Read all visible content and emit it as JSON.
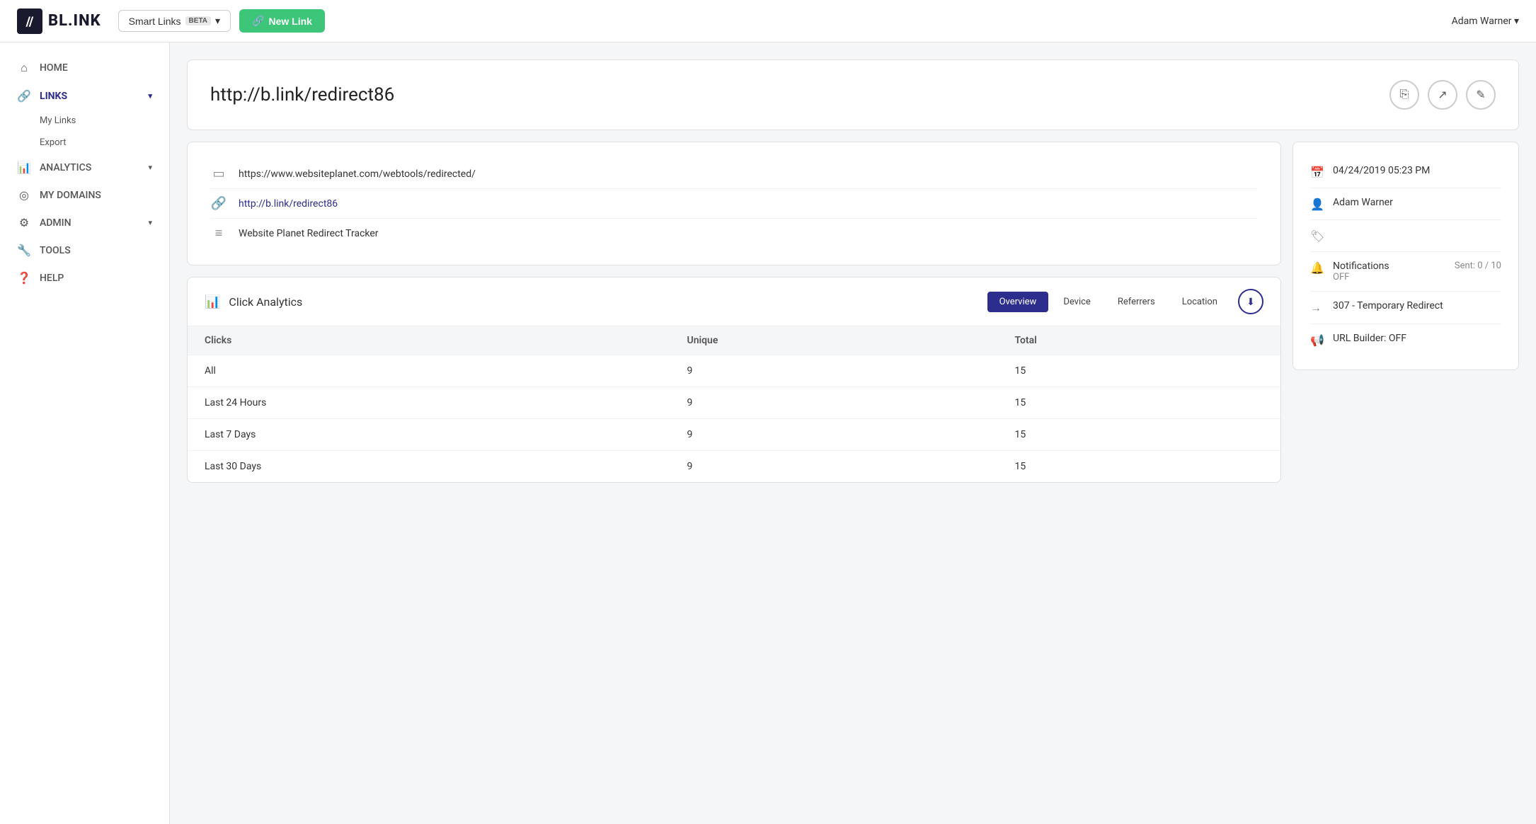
{
  "app": {
    "logo_text": "BL.INK",
    "smart_links_label": "Smart Links",
    "beta_badge": "BETA",
    "new_link_label": "New Link",
    "user_name": "Adam Warner ▾"
  },
  "sidebar": {
    "items": [
      {
        "id": "home",
        "label": "HOME",
        "icon": "⌂",
        "active": false
      },
      {
        "id": "links",
        "label": "LINKS",
        "icon": "🔗",
        "active": true,
        "has_chevron": true
      },
      {
        "id": "my-links",
        "label": "My Links",
        "sub": true
      },
      {
        "id": "export",
        "label": "Export",
        "sub": true
      },
      {
        "id": "analytics",
        "label": "ANALYTICS",
        "icon": "📊",
        "active": false,
        "has_chevron": true
      },
      {
        "id": "my-domains",
        "label": "MY DOMAINS",
        "icon": "◎",
        "active": false
      },
      {
        "id": "admin",
        "label": "ADMIN",
        "icon": "⚙",
        "active": false,
        "has_chevron": true
      },
      {
        "id": "tools",
        "label": "TOOLS",
        "icon": "🔧",
        "active": false
      },
      {
        "id": "help",
        "label": "HELP",
        "icon": "❓",
        "active": false
      }
    ]
  },
  "page": {
    "title": "http://b.link/redirect86",
    "actions": [
      {
        "id": "copy",
        "icon": "⎘"
      },
      {
        "id": "open",
        "icon": "↗"
      },
      {
        "id": "edit",
        "icon": "✎"
      }
    ]
  },
  "link_info": {
    "destination_url": "https://www.websiteplanet.com/webtools/redirected/",
    "short_url": "http://b.link/redirect86",
    "title": "Website Planet Redirect Tracker"
  },
  "analytics": {
    "section_title": "Click Analytics",
    "tabs": [
      {
        "id": "overview",
        "label": "Overview",
        "active": true
      },
      {
        "id": "device",
        "label": "Device",
        "active": false
      },
      {
        "id": "referrers",
        "label": "Referrers",
        "active": false
      },
      {
        "id": "location",
        "label": "Location",
        "active": false
      }
    ],
    "table": {
      "columns": [
        "Clicks",
        "Unique",
        "Total"
      ],
      "rows": [
        {
          "label": "All",
          "unique": "9",
          "total": "15"
        },
        {
          "label": "Last 24 Hours",
          "unique": "9",
          "total": "15"
        },
        {
          "label": "Last 7 Days",
          "unique": "9",
          "total": "15"
        },
        {
          "label": "Last 30 Days",
          "unique": "9",
          "total": "15"
        }
      ]
    }
  },
  "side_info": {
    "created_date": "04/24/2019 05:23 PM",
    "owner": "Adam Warner",
    "tag": "",
    "notifications": {
      "label": "Notifications",
      "status": "OFF",
      "sent": "Sent: 0 / 10"
    },
    "redirect_type": "307 - Temporary Redirect",
    "url_builder": "URL Builder: OFF"
  }
}
